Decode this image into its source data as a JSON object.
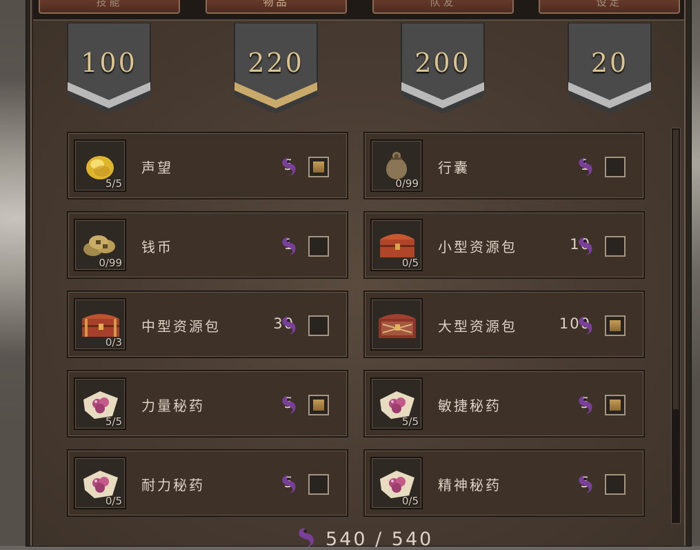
{
  "tabs": [
    {
      "label": "技能"
    },
    {
      "label": "物品"
    },
    {
      "label": "队友"
    },
    {
      "label": "设定"
    }
  ],
  "banners": [
    {
      "value": "100",
      "accent": "#b9b9b9"
    },
    {
      "value": "220",
      "accent": "#c9aa6b"
    },
    {
      "value": "200",
      "accent": "#b9b9b9"
    },
    {
      "value": "20",
      "accent": "#b9b9b9"
    }
  ],
  "items": [
    {
      "name": "声望",
      "count": "5/5",
      "cost": "5",
      "checked": true,
      "icon": "gold-nugget-icon"
    },
    {
      "name": "行囊",
      "count": "0/99",
      "cost": "1",
      "checked": false,
      "icon": "sack-icon"
    },
    {
      "name": "钱币",
      "count": "0/99",
      "cost": "1",
      "checked": false,
      "icon": "coins-icon"
    },
    {
      "name": "小型资源包",
      "count": "0/5",
      "cost": "10",
      "checked": false,
      "icon": "small-chest-icon"
    },
    {
      "name": "中型资源包",
      "count": "0/3",
      "cost": "30",
      "checked": false,
      "icon": "medium-chest-icon"
    },
    {
      "name": "大型资源包",
      "count": "",
      "cost": "100",
      "checked": true,
      "icon": "large-chest-icon"
    },
    {
      "name": "力量秘药",
      "count": "5/5",
      "cost": "5",
      "checked": true,
      "icon": "elixir-icon"
    },
    {
      "name": "敏捷秘药",
      "count": "5/5",
      "cost": "5",
      "checked": true,
      "icon": "elixir-icon"
    },
    {
      "name": "耐力秘药",
      "count": "0/5",
      "cost": "5",
      "checked": false,
      "icon": "elixir-icon"
    },
    {
      "name": "精神秘药",
      "count": "0/5",
      "cost": "5",
      "checked": false,
      "icon": "elixir-icon"
    }
  ],
  "total": {
    "text": "540 / 540",
    "icon": "soul-icon"
  },
  "colors": {
    "soul": "#7a3f9a",
    "check_fill": "#b08b48",
    "text": "#ddd2c4"
  }
}
